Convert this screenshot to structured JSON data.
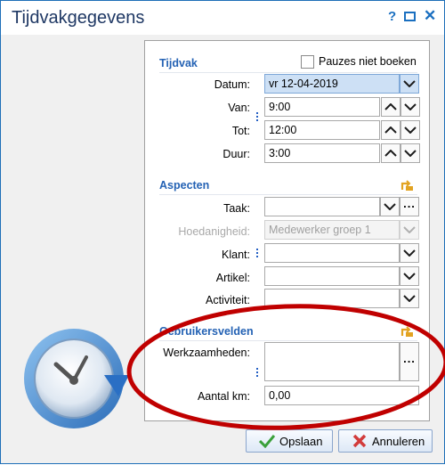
{
  "window": {
    "title": "Tijdvakgegevens",
    "help_glyph": "?",
    "close_glyph": "✕"
  },
  "tijdvak": {
    "section_title": "Tijdvak",
    "pauzes_label": "Pauzes niet boeken",
    "pauzes_checked": false,
    "datum_label": "Datum:",
    "datum_value": "vr 12-04-2019",
    "van_label": "Van:",
    "van_value": "9:00",
    "tot_label": "Tot:",
    "tot_value": "12:00",
    "duur_label": "Duur:",
    "duur_value": "3:00"
  },
  "aspecten": {
    "section_title": "Aspecten",
    "taak_label": "Taak:",
    "taak_value": "",
    "hoedanigheid_label": "Hoedanigheid:",
    "hoedanigheid_value": "Medewerker groep 1",
    "klant_label": "Klant:",
    "klant_value": "",
    "artikel_label": "Artikel:",
    "artikel_value": "",
    "activiteit_label": "Activiteit:",
    "activiteit_value": ""
  },
  "gebruikersvelden": {
    "section_title": "Gebruikersvelden",
    "werkzaamheden_label": "Werkzaamheden:",
    "werkzaamheden_value": "",
    "km_label": "Aantal km:",
    "km_value": "0,00"
  },
  "buttons": {
    "ellipsis": "...",
    "save_label": "Opslaan",
    "cancel_label": "Annuleren"
  },
  "colors": {
    "accent": "#2462b4",
    "highlight_ellipse": "#c00000",
    "selected_field": "#cde0f5"
  },
  "icons": {
    "up": "chevron-up-icon",
    "down": "chevron-down-icon",
    "reset": "reset-icon",
    "save": "checkmark-icon",
    "cancel": "cross-icon",
    "clock": "clock-icon"
  }
}
